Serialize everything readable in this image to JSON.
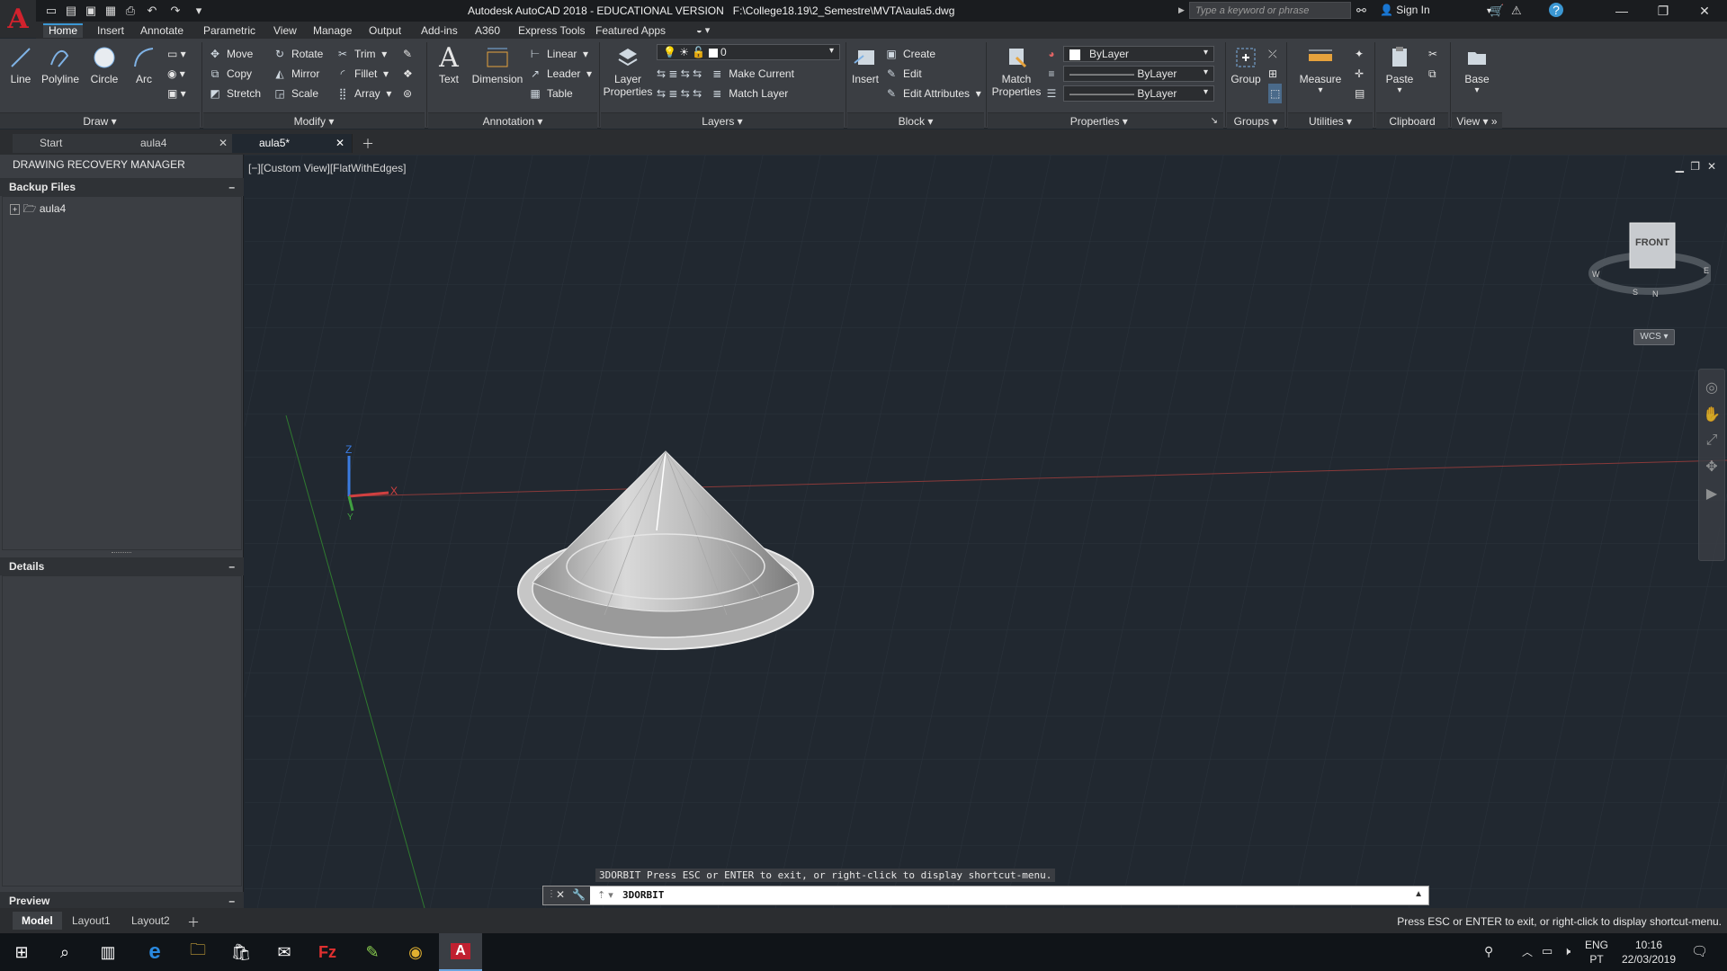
{
  "title_bar": {
    "title": "Autodesk AutoCAD 2018 - EDUCATIONAL VERSION",
    "file_path": "F:\\College18.19\\2_Semestre\\MVTA\\aula5.dwg",
    "search_placeholder": "Type a keyword or phrase",
    "signin_label": "Sign In"
  },
  "menu_tabs": [
    "Home",
    "Insert",
    "Annotate",
    "Parametric",
    "View",
    "Manage",
    "Output",
    "Add-ins",
    "A360",
    "Express Tools",
    "Featured Apps"
  ],
  "ribbon": {
    "draw": {
      "panel": "Draw",
      "big": [
        "Line",
        "Polyline",
        "Circle",
        "Arc"
      ]
    },
    "modify": {
      "panel": "Modify",
      "col1": [
        "Move",
        "Copy",
        "Stretch"
      ],
      "col2": [
        "Rotate",
        "Mirror",
        "Scale"
      ],
      "col3": [
        "Trim",
        "Fillet",
        "Array"
      ]
    },
    "annotation": {
      "panel": "Annotation",
      "big": [
        "Text",
        "Dimension"
      ],
      "small": [
        "Linear",
        "Leader",
        "Table"
      ]
    },
    "layers": {
      "panel": "Layers",
      "big_line1": "Layer",
      "big_line2": "Properties",
      "layer_value": "0",
      "small": [
        "Make Current",
        "Match Layer"
      ]
    },
    "block": {
      "panel": "Block",
      "big": "Insert",
      "small": [
        "Create",
        "Edit",
        "Edit Attributes"
      ]
    },
    "properties": {
      "panel": "Properties",
      "big_line1": "Match",
      "big_line2": "Properties",
      "combos": [
        "ByLayer",
        "ByLayer",
        "ByLayer"
      ]
    },
    "groups": {
      "panel": "Groups",
      "big": "Group"
    },
    "utilities": {
      "panel": "Utilities",
      "big": "Measure"
    },
    "clipboard": {
      "panel": "Clipboard",
      "big": "Paste"
    },
    "view": {
      "panel": "View",
      "big": "Base"
    }
  },
  "doc_tabs": [
    "Start",
    "aula4",
    "aula5*"
  ],
  "left_panel": {
    "title": "DRAWING RECOVERY MANAGER",
    "backup_header": "Backup Files",
    "backup_item": "aula4",
    "details_header": "Details",
    "preview_header": "Preview"
  },
  "viewport": {
    "label": "[−][Custom View][FlatWithEdges]",
    "viewcube_face": "FRONT",
    "wcs_label": "WCS",
    "axis_z": "Z",
    "axis_x": "X",
    "axis_y": "Y"
  },
  "command": {
    "history": "3DORBIT Press ESC or ENTER to exit, or right-click to display shortcut-menu.",
    "input": "3DORBIT"
  },
  "layout_tabs": [
    "Model",
    "Layout1",
    "Layout2"
  ],
  "status_message": "Press ESC or ENTER to exit, or right-click to display shortcut-menu.",
  "taskbar": {
    "lang_line1": "ENG",
    "lang_line2": "PT",
    "time": "10:16",
    "date": "22/03/2019"
  },
  "colors": {
    "accent": "#3b97d3",
    "logo_red": "#d2222d",
    "viewport_bg": "#212830"
  }
}
